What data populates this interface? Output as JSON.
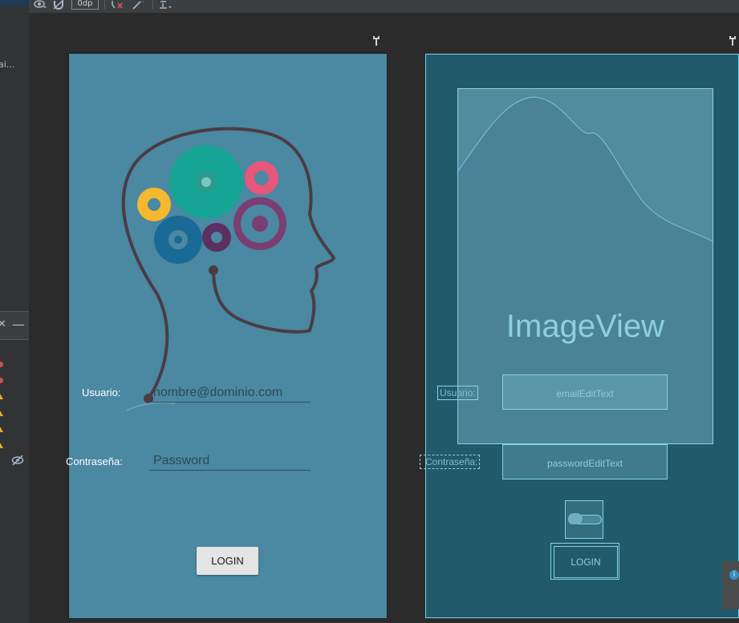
{
  "toolbar": {
    "dp_value": "0dp"
  },
  "left_panel": {
    "truncated_text": "ai..."
  },
  "design_view": {
    "username_label": "Usuario:",
    "password_label": "Contraseña:",
    "email_placeholder": "nombre@dominio.com",
    "password_placeholder": "Password",
    "login_label": "LOGIN",
    "background_color": "#4b88a2"
  },
  "blueprint_view": {
    "image_label": "ImageView",
    "username_label": "Usuario:",
    "password_label": "Contraseña:",
    "email_field": "emailEditText",
    "password_field": "passwordEditText",
    "login_label": "LOGIN",
    "background_color": "#215a6b"
  },
  "icons": {
    "gear_colors": [
      "#16a495",
      "#e8567a",
      "#f5b82e",
      "#1a6a97",
      "#7b3e72",
      "#5b3060"
    ]
  }
}
